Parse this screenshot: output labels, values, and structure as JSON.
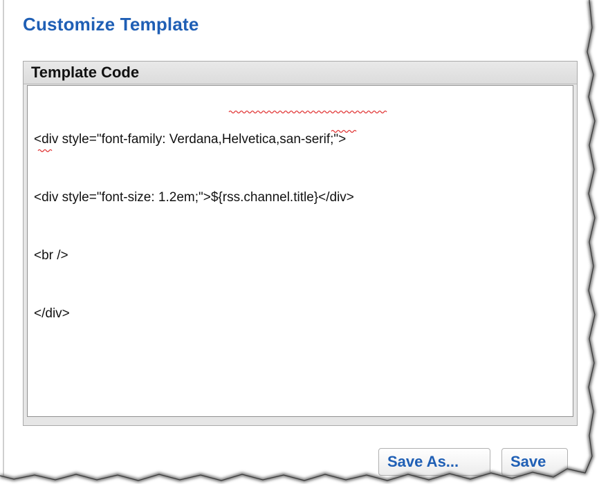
{
  "heading": "Customize Template",
  "panel": {
    "header": "Template Code",
    "code_lines": [
      "<div style=\"font-family: Verdana,Helvetica,san-serif;\">",
      "<div style=\"font-size: 1.2em;\">${rss.channel.title}</div>",
      "<br />",
      "</div>"
    ]
  },
  "buttons": {
    "save_as": "Save As...",
    "save": "Save"
  },
  "colors": {
    "heading": "#1f5fb5",
    "button_text": "#1f5fb5",
    "panel_header_bg": "#e2e2e2",
    "spellcheck_underline": "#e03030"
  }
}
